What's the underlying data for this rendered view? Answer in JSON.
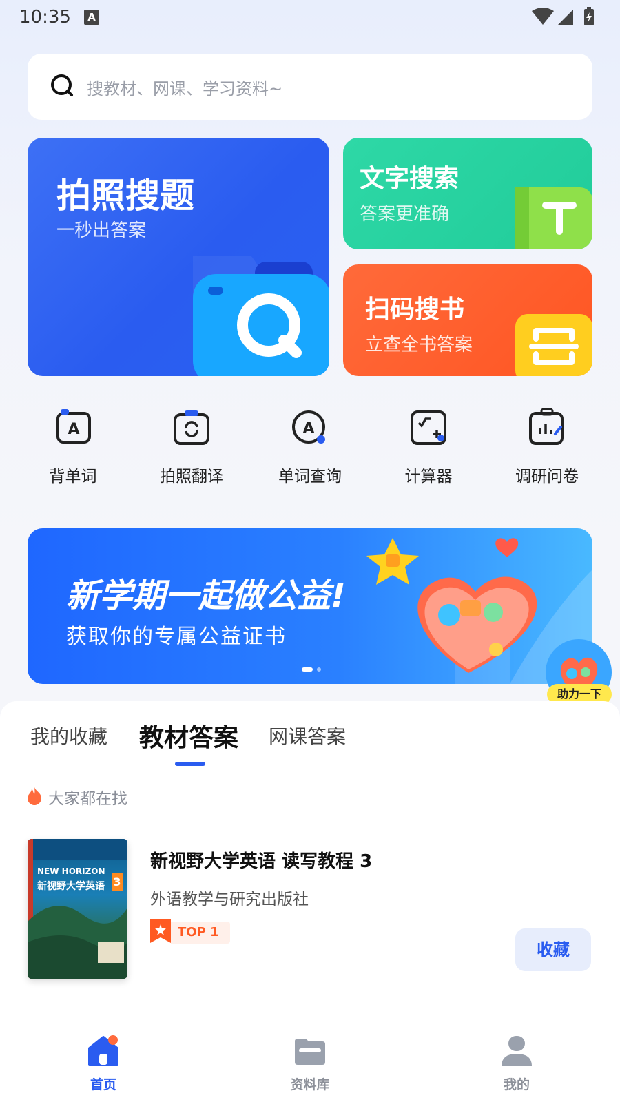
{
  "status_bar": {
    "time": "10:35",
    "notification_glyph": "A"
  },
  "search": {
    "placeholder": "搜教材、网课、学习资料~",
    "icon": "search-icon"
  },
  "feature_cards": {
    "photo_search": {
      "title": "拍照搜题",
      "subtitle": "一秒出答案",
      "icon": "camera-icon"
    },
    "text_search": {
      "title": "文字搜索",
      "subtitle": "答案更准确",
      "icon": "text-t-icon"
    },
    "scan_book": {
      "title": "扫码搜书",
      "subtitle": "立查全书答案",
      "icon": "scan-icon"
    }
  },
  "tools": [
    {
      "label": "背单词",
      "icon": "flashcard-icon"
    },
    {
      "label": "拍照翻译",
      "icon": "photo-translate-icon"
    },
    {
      "label": "单词查询",
      "icon": "word-lookup-icon"
    },
    {
      "label": "计算器",
      "icon": "calculator-icon"
    },
    {
      "label": "调研问卷",
      "icon": "survey-icon"
    }
  ],
  "banner": {
    "title": "新学期一起做公益!",
    "subtitle": "获取你的专属公益证书",
    "slide_count": 2,
    "active_slide": 1
  },
  "floating_help": {
    "label": "助力一下"
  },
  "tabs": [
    {
      "label": "我的收藏",
      "active": false
    },
    {
      "label": "教材答案",
      "active": true
    },
    {
      "label": "网课答案",
      "active": false
    }
  ],
  "hot_section": {
    "label": "大家都在找",
    "icon": "fire-icon"
  },
  "book_list": [
    {
      "title": "新视野大学英语 读写教程 3",
      "publisher": "外语教学与研究出版社",
      "badge": "TOP 1",
      "action_label": "收藏",
      "cover_title": "新视野大学英语",
      "cover_brand": "NEW HORIZON",
      "cover_volume": "3"
    }
  ],
  "bottom_nav": [
    {
      "label": "首页",
      "icon": "home-icon",
      "active": true
    },
    {
      "label": "资料库",
      "icon": "folder-icon",
      "active": false
    },
    {
      "label": "我的",
      "icon": "profile-icon",
      "active": false
    }
  ],
  "colors": {
    "primary": "#2a5cf0",
    "photo_card": "#2f63f2",
    "text_card": "#24cf9d",
    "scan_card": "#ff5a26",
    "badge": "#ff5a22"
  }
}
